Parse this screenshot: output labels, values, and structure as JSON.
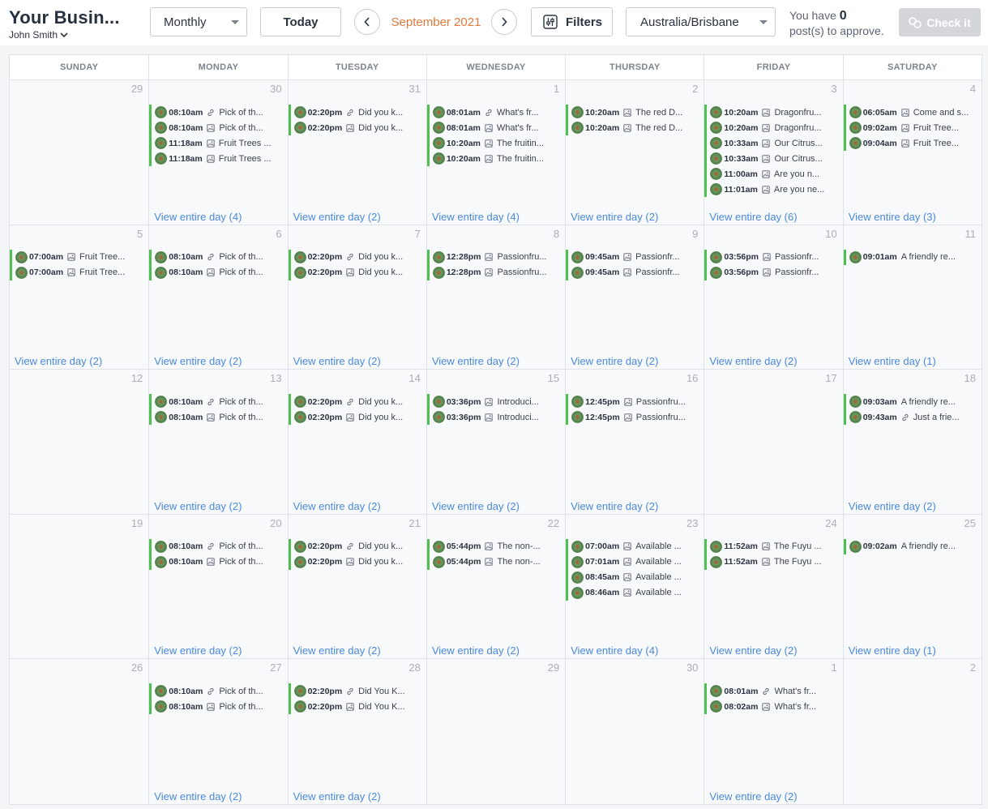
{
  "header": {
    "business_name": "Your Busin...",
    "user_name": "John Smith",
    "view_select": "Monthly",
    "today_label": "Today",
    "month_label": "September 2021",
    "filters_label": "Filters",
    "timezone": "Australia/Brisbane",
    "approve_prefix": "You have",
    "approve_count": "0",
    "approve_suffix": "post(s) to approve.",
    "check_it_label": "Check it"
  },
  "colors": {
    "accent": "#e07a3f",
    "post_bar": "#4fbf4f",
    "link": "#4a89dc"
  },
  "weekdays": [
    "SUNDAY",
    "MONDAY",
    "TUESDAY",
    "WEDNESDAY",
    "THURSDAY",
    "FRIDAY",
    "SATURDAY"
  ],
  "weeks": [
    [
      {
        "num": "29",
        "posts": [],
        "view_all": ""
      },
      {
        "num": "30",
        "posts": [
          {
            "time": "08:10am",
            "type": "link",
            "text": "Pick of th..."
          },
          {
            "time": "08:10am",
            "type": "image",
            "text": "Pick of th..."
          },
          {
            "time": "11:18am",
            "type": "image",
            "text": "Fruit Trees ..."
          },
          {
            "time": "11:18am",
            "type": "image",
            "text": "Fruit Trees ..."
          }
        ],
        "view_all": "View entire day (4)"
      },
      {
        "num": "31",
        "posts": [
          {
            "time": "02:20pm",
            "type": "link",
            "text": "Did you k..."
          },
          {
            "time": "02:20pm",
            "type": "image",
            "text": "Did you k..."
          }
        ],
        "view_all": "View entire day (2)"
      },
      {
        "num": "1",
        "posts": [
          {
            "time": "08:01am",
            "type": "link",
            "text": "What's fr..."
          },
          {
            "time": "08:01am",
            "type": "image",
            "text": "What's fr..."
          },
          {
            "time": "10:20am",
            "type": "image",
            "text": "The fruitin..."
          },
          {
            "time": "10:20am",
            "type": "image",
            "text": "The fruitin..."
          }
        ],
        "view_all": "View entire day (4)"
      },
      {
        "num": "2",
        "posts": [
          {
            "time": "10:20am",
            "type": "image",
            "text": "The red D..."
          },
          {
            "time": "10:20am",
            "type": "image",
            "text": "The red D..."
          }
        ],
        "view_all": "View entire day (2)"
      },
      {
        "num": "3",
        "posts": [
          {
            "time": "10:20am",
            "type": "image",
            "text": "Dragonfru..."
          },
          {
            "time": "10:20am",
            "type": "image",
            "text": "Dragonfru..."
          },
          {
            "time": "10:33am",
            "type": "image",
            "text": "Our Citrus..."
          },
          {
            "time": "10:33am",
            "type": "image",
            "text": "Our Citrus..."
          },
          {
            "time": "11:00am",
            "type": "image",
            "text": "Are you n..."
          },
          {
            "time": "11:01am",
            "type": "image",
            "text": "Are you ne..."
          }
        ],
        "view_all": "View entire day (6)"
      },
      {
        "num": "4",
        "posts": [
          {
            "time": "06:05am",
            "type": "image",
            "text": "Come and s..."
          },
          {
            "time": "09:02am",
            "type": "image",
            "text": "Fruit Tree..."
          },
          {
            "time": "09:04am",
            "type": "image",
            "text": "Fruit Tree..."
          }
        ],
        "view_all": "View entire day (3)"
      }
    ],
    [
      {
        "num": "5",
        "posts": [
          {
            "time": "07:00am",
            "type": "image",
            "text": "Fruit Tree..."
          },
          {
            "time": "07:00am",
            "type": "image",
            "text": "Fruit Tree..."
          }
        ],
        "view_all": "View entire day (2)"
      },
      {
        "num": "6",
        "posts": [
          {
            "time": "08:10am",
            "type": "link",
            "text": "Pick of th..."
          },
          {
            "time": "08:10am",
            "type": "image",
            "text": "Pick of th..."
          }
        ],
        "view_all": "View entire day (2)"
      },
      {
        "num": "7",
        "posts": [
          {
            "time": "02:20pm",
            "type": "link",
            "text": "Did you k..."
          },
          {
            "time": "02:20pm",
            "type": "image",
            "text": "Did you k..."
          }
        ],
        "view_all": "View entire day (2)"
      },
      {
        "num": "8",
        "posts": [
          {
            "time": "12:28pm",
            "type": "image",
            "text": "Passionfru..."
          },
          {
            "time": "12:28pm",
            "type": "image",
            "text": "Passionfru..."
          }
        ],
        "view_all": "View entire day (2)"
      },
      {
        "num": "9",
        "posts": [
          {
            "time": "09:45am",
            "type": "image",
            "text": "Passionfr..."
          },
          {
            "time": "09:45am",
            "type": "image",
            "text": "Passionfr..."
          }
        ],
        "view_all": "View entire day (2)"
      },
      {
        "num": "10",
        "posts": [
          {
            "time": "03:56pm",
            "type": "image",
            "text": "Passionfr..."
          },
          {
            "time": "03:56pm",
            "type": "image",
            "text": "Passionfr..."
          }
        ],
        "view_all": "View entire day (2)"
      },
      {
        "num": "11",
        "posts": [
          {
            "time": "09:01am",
            "type": "none",
            "text": "A friendly re..."
          }
        ],
        "view_all": "View entire day (1)"
      }
    ],
    [
      {
        "num": "12",
        "posts": [],
        "view_all": ""
      },
      {
        "num": "13",
        "posts": [
          {
            "time": "08:10am",
            "type": "link",
            "text": "Pick of th..."
          },
          {
            "time": "08:10am",
            "type": "image",
            "text": "Pick of th..."
          }
        ],
        "view_all": "View entire day (2)"
      },
      {
        "num": "14",
        "posts": [
          {
            "time": "02:20pm",
            "type": "link",
            "text": "Did you k..."
          },
          {
            "time": "02:20pm",
            "type": "image",
            "text": "Did you k..."
          }
        ],
        "view_all": "View entire day (2)"
      },
      {
        "num": "15",
        "posts": [
          {
            "time": "03:36pm",
            "type": "image",
            "text": "Introduci..."
          },
          {
            "time": "03:36pm",
            "type": "image",
            "text": "Introduci..."
          }
        ],
        "view_all": "View entire day (2)"
      },
      {
        "num": "16",
        "posts": [
          {
            "time": "12:45pm",
            "type": "image",
            "text": "Passionfru..."
          },
          {
            "time": "12:45pm",
            "type": "image",
            "text": "Passionfru..."
          }
        ],
        "view_all": "View entire day (2)"
      },
      {
        "num": "17",
        "posts": [],
        "view_all": ""
      },
      {
        "num": "18",
        "posts": [
          {
            "time": "09:03am",
            "type": "none",
            "text": "A friendly re..."
          },
          {
            "time": "09:43am",
            "type": "link",
            "text": "Just a frie..."
          }
        ],
        "view_all": "View entire day (2)"
      }
    ],
    [
      {
        "num": "19",
        "posts": [],
        "view_all": ""
      },
      {
        "num": "20",
        "posts": [
          {
            "time": "08:10am",
            "type": "link",
            "text": "Pick of th..."
          },
          {
            "time": "08:10am",
            "type": "image",
            "text": "Pick of th..."
          }
        ],
        "view_all": "View entire day (2)"
      },
      {
        "num": "21",
        "posts": [
          {
            "time": "02:20pm",
            "type": "link",
            "text": "Did you k..."
          },
          {
            "time": "02:20pm",
            "type": "image",
            "text": "Did you k..."
          }
        ],
        "view_all": "View entire day (2)"
      },
      {
        "num": "22",
        "posts": [
          {
            "time": "05:44pm",
            "type": "image",
            "text": "The non-..."
          },
          {
            "time": "05:44pm",
            "type": "image",
            "text": "The non-..."
          }
        ],
        "view_all": "View entire day (2)"
      },
      {
        "num": "23",
        "posts": [
          {
            "time": "07:00am",
            "type": "image",
            "text": "Available ..."
          },
          {
            "time": "07:01am",
            "type": "image",
            "text": "Available ..."
          },
          {
            "time": "08:45am",
            "type": "image",
            "text": "Available ..."
          },
          {
            "time": "08:46am",
            "type": "image",
            "text": "Available ..."
          }
        ],
        "view_all": "View entire day (4)"
      },
      {
        "num": "24",
        "posts": [
          {
            "time": "11:52am",
            "type": "image",
            "text": "The Fuyu ..."
          },
          {
            "time": "11:52am",
            "type": "image",
            "text": "The Fuyu ..."
          }
        ],
        "view_all": "View entire day (2)"
      },
      {
        "num": "25",
        "posts": [
          {
            "time": "09:02am",
            "type": "none",
            "text": "A friendly re..."
          }
        ],
        "view_all": "View entire day (1)"
      }
    ],
    [
      {
        "num": "26",
        "posts": [],
        "view_all": ""
      },
      {
        "num": "27",
        "posts": [
          {
            "time": "08:10am",
            "type": "link",
            "text": "Pick of th..."
          },
          {
            "time": "08:10am",
            "type": "image",
            "text": "Pick of th..."
          }
        ],
        "view_all": "View entire day (2)"
      },
      {
        "num": "28",
        "posts": [
          {
            "time": "02:20pm",
            "type": "link",
            "text": "Did You K..."
          },
          {
            "time": "02:20pm",
            "type": "image",
            "text": "Did You K..."
          }
        ],
        "view_all": "View entire day (2)"
      },
      {
        "num": "29",
        "posts": [],
        "view_all": ""
      },
      {
        "num": "30",
        "posts": [],
        "view_all": ""
      },
      {
        "num": "1",
        "posts": [
          {
            "time": "08:01am",
            "type": "link",
            "text": "What's fr..."
          },
          {
            "time": "08:02am",
            "type": "image",
            "text": "What's fr..."
          }
        ],
        "view_all": "View entire day (2)"
      },
      {
        "num": "2",
        "posts": [],
        "view_all": ""
      }
    ]
  ]
}
